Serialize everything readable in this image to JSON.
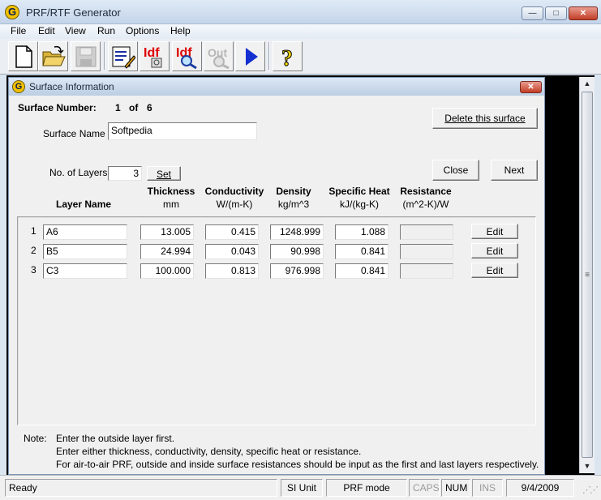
{
  "app": {
    "title": "PRF/RTF Generator",
    "icon": "G"
  },
  "menu": [
    "File",
    "Edit",
    "View",
    "Run",
    "Options",
    "Help"
  ],
  "toolbar": [
    {
      "icon": "new-document-icon"
    },
    {
      "icon": "open-folder-icon"
    },
    {
      "icon": "save-icon",
      "disabled": true
    },
    {
      "icon": "edit-list-icon"
    },
    {
      "icon": "idf-import-icon",
      "text": "Idf"
    },
    {
      "icon": "idf-search-icon",
      "text": "Idf"
    },
    {
      "icon": "out-icon",
      "text": "Out",
      "disabled": true
    },
    {
      "icon": "run-arrow-icon"
    },
    {
      "icon": "help-icon",
      "text": "?"
    }
  ],
  "dialog": {
    "title": "Surface Information",
    "surface_number_label": "Surface Number:",
    "surface_number": "1",
    "of_label": "of",
    "surface_total": "6",
    "surface_name_label": "Surface Name",
    "surface_name": "Softpedia",
    "layers_label": "No. of Layers",
    "layers_count": "3",
    "set_button": "Set",
    "delete_button": "Delete this surface",
    "close_button": "Close",
    "next_button": "Next",
    "columns": {
      "layer_name": "Layer Name",
      "thickness": "Thickness",
      "thickness_unit": "mm",
      "conductivity": "Conductivity",
      "conductivity_unit": "W/(m-K)",
      "density": "Density",
      "density_unit": "kg/m^3",
      "specific_heat": "Specific Heat",
      "specific_heat_unit": "kJ/(kg-K)",
      "resistance": "Resistance",
      "resistance_unit": "(m^2-K)/W"
    },
    "layers": [
      {
        "index": "1",
        "name": "A6",
        "thickness": "13.005",
        "conductivity": "0.415",
        "density": "1248.999",
        "specific_heat": "1.088",
        "resistance": "",
        "edit": "Edit"
      },
      {
        "index": "2",
        "name": "B5",
        "thickness": "24.994",
        "conductivity": "0.043",
        "density": "90.998",
        "specific_heat": "0.841",
        "resistance": "",
        "edit": "Edit"
      },
      {
        "index": "3",
        "name": "C3",
        "thickness": "100.000",
        "conductivity": "0.813",
        "density": "976.998",
        "specific_heat": "0.841",
        "resistance": "",
        "edit": "Edit"
      }
    ],
    "note_label": "Note:",
    "notes": [
      "Enter the outside layer first.",
      "Enter either thickness, conductivity, density, specific heat or resistance.",
      "For air-to-air PRF, outside and inside surface resistances should be input as the first and last layers respectively."
    ]
  },
  "status": {
    "message": "Ready",
    "unit": "SI Unit",
    "mode": "PRF mode",
    "caps": "CAPS",
    "num": "NUM",
    "ins": "INS",
    "date": "9/4/2009"
  }
}
